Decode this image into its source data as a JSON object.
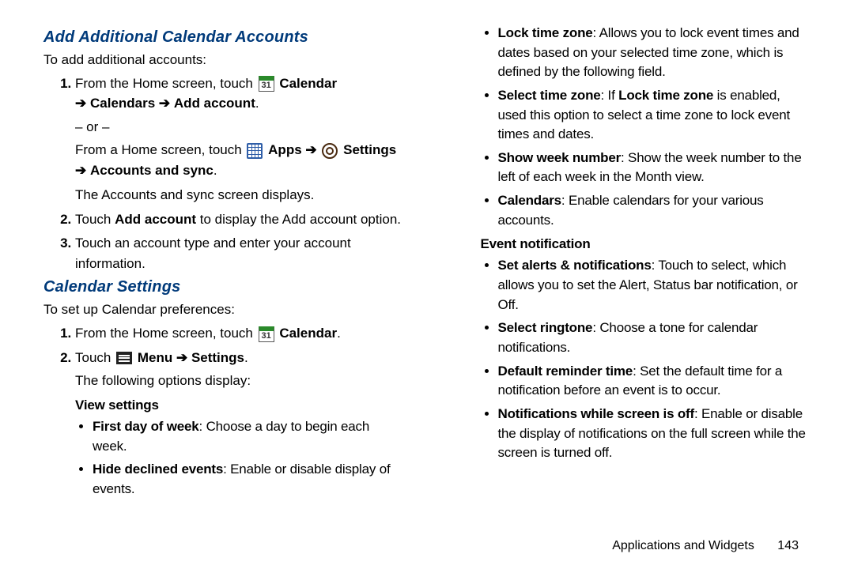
{
  "sections": {
    "addAccounts": {
      "heading": "Add Additional Calendar Accounts",
      "intro": "To add additional accounts:",
      "step1_a": "From the Home screen, touch ",
      "step1_cal": "Calendar",
      "step1_line2_arrow1": "➔",
      "step1_calendars": "Calendars",
      "step1_arrow2": "➔",
      "step1_addacct": "Add account",
      "or": "– or –",
      "step1_alt_a": "From a Home screen, touch ",
      "step1_apps": "Apps",
      "step1_arrow3": "➔",
      "step1_settings": "Settings",
      "step1_arrow4": "➔",
      "step1_acctsync": "Accounts and sync",
      "step1_result": "The Accounts and sync screen displays.",
      "step2_a": "Touch ",
      "step2_add": "Add account",
      "step2_b": " to display the Add account option.",
      "step3": "Touch an account type and enter your account information."
    },
    "calSettings": {
      "heading": "Calendar Settings",
      "intro": "To set up Calendar preferences:",
      "step1_a": "From the Home screen, touch ",
      "step1_cal": "Calendar",
      "step2_a": "Touch ",
      "step2_menu": "Menu",
      "step2_arrow": "➔",
      "step2_set": "Settings",
      "step2_result": "The following options display:"
    },
    "viewSettings": {
      "title": "View settings",
      "firstDay_b": "First day of week",
      "firstDay_t": ": Choose a day to begin each week.",
      "hideDecl_b": "Hide declined events",
      "hideDecl_t": ": Enable or disable display of events.",
      "lockTz_b": "Lock time zone",
      "lockTz_t": ": Allows you to lock event times and dates based on your selected time zone, which is defined by the following field.",
      "selTz_b": "Select time zone",
      "selTz_t1": ": If ",
      "selTz_b2": "Lock time zone",
      "selTz_t2": " is enabled, used this option to select a time zone to lock event times and dates.",
      "weekNum_b": "Show week number",
      "weekNum_t": ": Show the week number to the left of each week in the Month view.",
      "cals_b": "Calendars",
      "cals_t": ": Enable calendars for your various accounts."
    },
    "eventNotif": {
      "title": "Event notification",
      "alerts_b": "Set alerts & notifications",
      "alerts_t": ": Touch to select, which allows you to set the Alert, Status bar notification, or Off.",
      "ring_b": "Select ringtone",
      "ring_t": ": Choose a tone for calendar notifications.",
      "remind_b": "Default reminder time",
      "remind_t": ": Set the default time for a notification before an event is to occur.",
      "screenOff_b": "Notifications while screen is off",
      "screenOff_t": ": Enable or disable the display of notifications on the full screen while the screen is turned off."
    }
  },
  "icons": {
    "cal31": "31"
  },
  "footer": {
    "section": "Applications and Widgets",
    "page": "143"
  }
}
